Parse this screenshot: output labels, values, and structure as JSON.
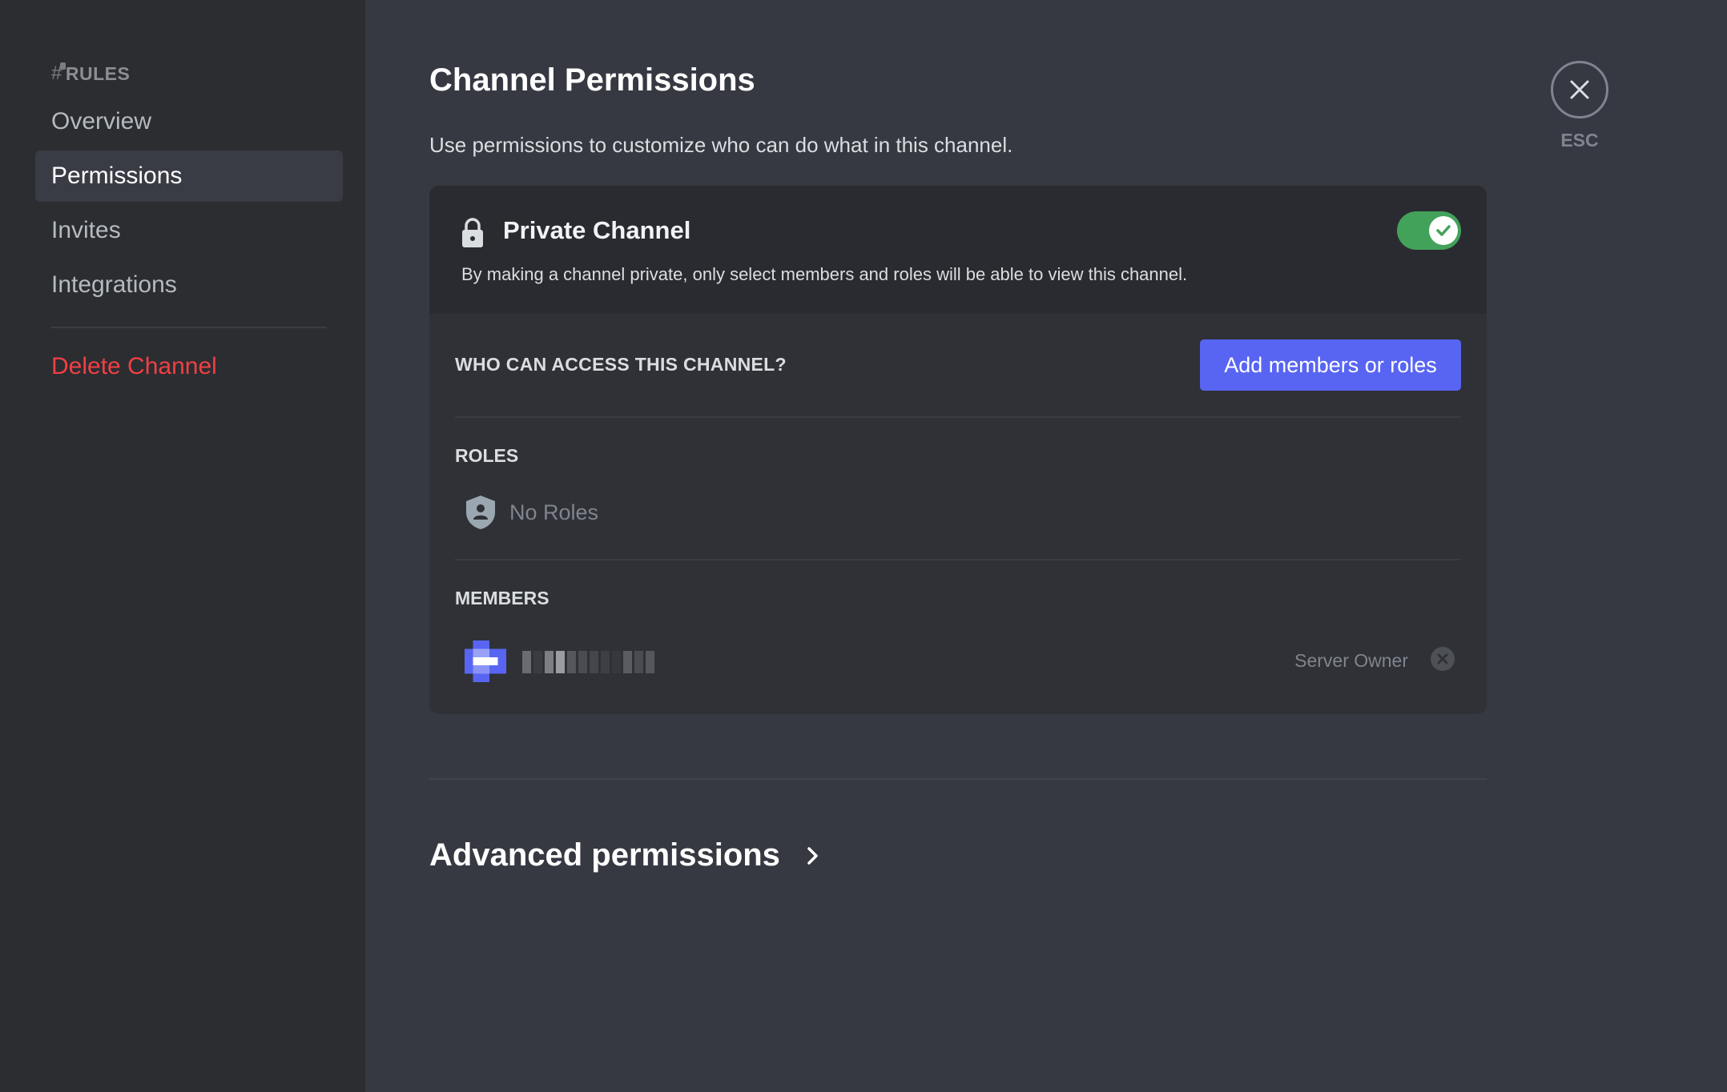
{
  "sidebar": {
    "header": "RULES",
    "items": [
      {
        "label": "Overview",
        "active": false
      },
      {
        "label": "Permissions",
        "active": true
      },
      {
        "label": "Invites",
        "active": false
      },
      {
        "label": "Integrations",
        "active": false
      }
    ],
    "danger_item": "Delete Channel"
  },
  "main": {
    "title": "Channel Permissions",
    "description": "Use permissions to customize who can do what in this channel.",
    "private_channel": {
      "title": "Private Channel",
      "description": "By making a channel private, only select members and roles will be able to view this channel.",
      "enabled": true
    },
    "access": {
      "label": "WHO CAN ACCESS THIS CHANNEL?",
      "add_button": "Add members or roles"
    },
    "roles": {
      "label": "ROLES",
      "empty_text": "No Roles"
    },
    "members": {
      "label": "MEMBERS",
      "items": [
        {
          "name": "[redacted]",
          "tag": "Server Owner"
        }
      ]
    },
    "advanced": "Advanced permissions"
  },
  "close": {
    "label": "ESC"
  },
  "colors": {
    "accent": "#5865f2",
    "toggle_on": "#43a25a",
    "danger": "#f23f43"
  }
}
